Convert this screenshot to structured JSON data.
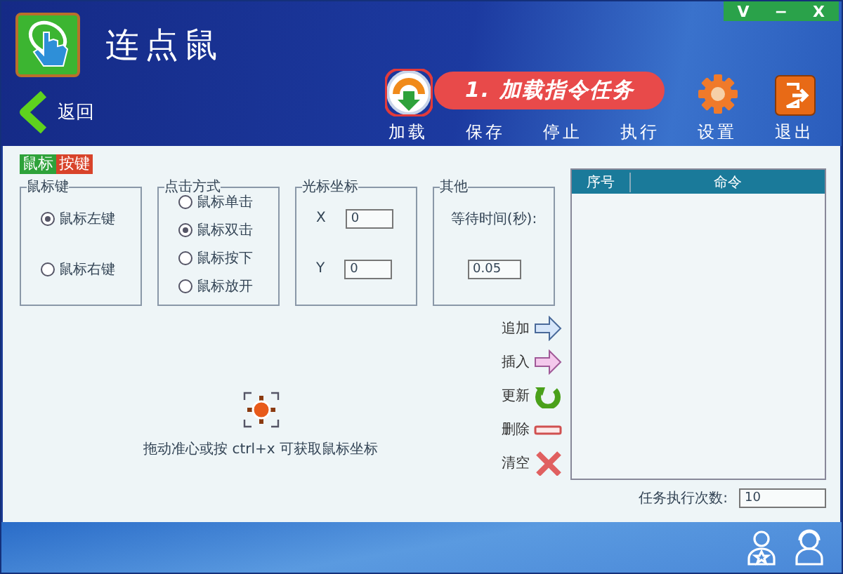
{
  "window": {
    "title": "连点鼠",
    "controls": [
      "V",
      "−",
      "X"
    ]
  },
  "back": {
    "label": "返回"
  },
  "toolbar": [
    {
      "label": "加载",
      "kind": "load"
    },
    {
      "label": "保存",
      "kind": "plain"
    },
    {
      "label": "停止",
      "kind": "plain"
    },
    {
      "label": "执行",
      "kind": "plain"
    },
    {
      "label": "设置",
      "kind": "settings"
    },
    {
      "label": "退出",
      "kind": "exit"
    }
  ],
  "callout": {
    "text": "1. 加载指令任务"
  },
  "tabs": [
    {
      "label": "鼠标",
      "color": "#2ea23a"
    },
    {
      "label": "按键",
      "color": "#d8432a"
    }
  ],
  "mouse_button": {
    "title": "鼠标键",
    "options": [
      {
        "label": "鼠标左键",
        "selected": true
      },
      {
        "label": "鼠标右键",
        "selected": false
      }
    ]
  },
  "click_mode": {
    "title": "点击方式",
    "options": [
      {
        "label": "鼠标单击",
        "selected": false
      },
      {
        "label": "鼠标双击",
        "selected": true
      },
      {
        "label": "鼠标按下",
        "selected": false
      },
      {
        "label": "鼠标放开",
        "selected": false
      }
    ]
  },
  "cursor_coords": {
    "title": "光标坐标",
    "x_label": "X",
    "x_value": "0",
    "y_label": "Y",
    "y_value": "0"
  },
  "other": {
    "title": "其他",
    "wait_label": "等待时间(秒):",
    "wait_value": "0.05"
  },
  "hint": "拖动准心或按 ctrl+x 可获取鼠标坐标",
  "actions": [
    {
      "label": "追加",
      "kind": "append"
    },
    {
      "label": "插入",
      "kind": "insert"
    },
    {
      "label": "更新",
      "kind": "update"
    },
    {
      "label": "删除",
      "kind": "delete"
    },
    {
      "label": "清空",
      "kind": "clear"
    }
  ],
  "table": {
    "columns": [
      "序号",
      "命令"
    ]
  },
  "run_count": {
    "label": "任务执行次数:",
    "value": "10"
  }
}
